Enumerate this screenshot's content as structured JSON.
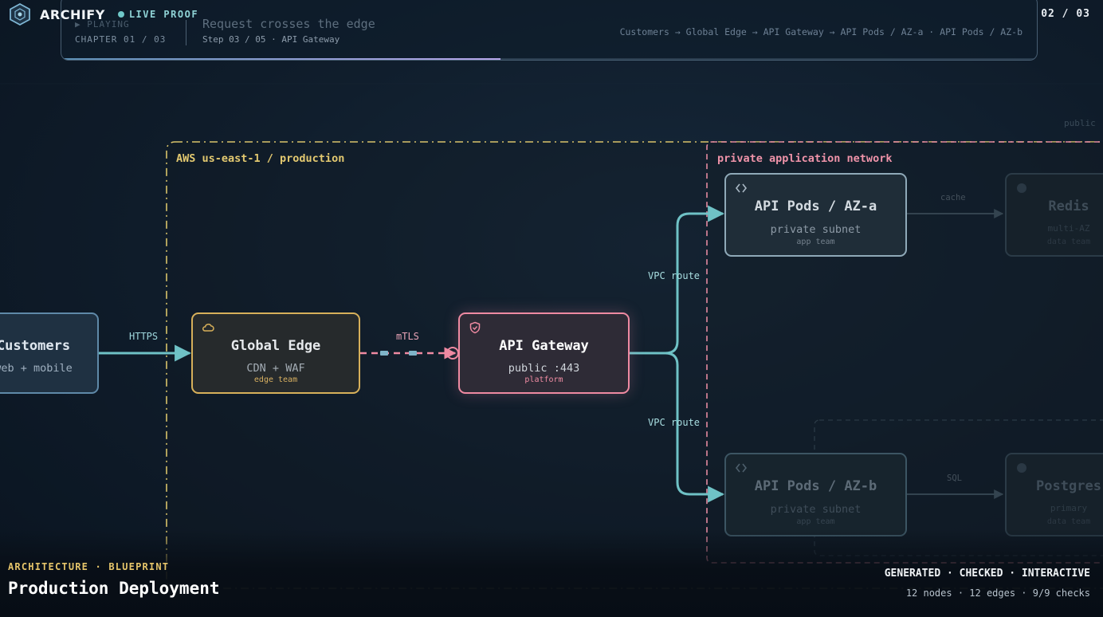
{
  "app": {
    "name": "ARCHIFY",
    "status": "LIVE PROOF",
    "page_counter": "02 / 03"
  },
  "chapter_card": {
    "now_playing": "▶ PLAYING",
    "chapter": "CHAPTER 01 / 03",
    "title": "Request crosses the edge",
    "step": "Step 03 / 05 · API Gateway",
    "path": "Customers → Global Edge → API Gateway → API Pods / AZ-a · API Pods / AZ-b",
    "progress": 0.45
  },
  "diagram": {
    "regions": {
      "aws": "AWS us-east-1 / production",
      "private": "private application network",
      "public_hint": "public"
    },
    "nodes": {
      "customers": {
        "title": "Customers",
        "sub": "web + mobile"
      },
      "edge": {
        "title": "Global Edge",
        "sub": "CDN + WAF",
        "owner": "edge team"
      },
      "gateway": {
        "title": "API Gateway",
        "sub": "public :443",
        "owner": "platform"
      },
      "pods_a": {
        "title": "API Pods / AZ-a",
        "sub": "private subnet",
        "owner": "app team"
      },
      "pods_b": {
        "title": "API Pods / AZ-b",
        "sub": "private subnet",
        "owner": "app team"
      },
      "redis": {
        "title": "Redis",
        "sub": "multi-AZ",
        "owner": "data team"
      },
      "postgres": {
        "title": "Postgres",
        "sub": "primary",
        "owner": "data team"
      }
    },
    "edges": {
      "https": "HTTPS",
      "mtls": "mTLS",
      "vpc_a": "VPC route",
      "vpc_b": "VPC route",
      "cache": "cache",
      "sql": "SQL"
    },
    "colors": {
      "active_edge": "#6fc2c6",
      "edge_node": "#d7b05a",
      "gateway_node": "#ef8aa2",
      "region_aws": "#d9c36a",
      "region_private": "#e58aa0"
    }
  },
  "footer": {
    "eyebrow": "ARCHITECTURE · BLUEPRINT",
    "title": "Production Deployment",
    "flags": "GENERATED · CHECKED · INTERACTIVE",
    "stats": "12 nodes · 12 edges · 9/9 checks"
  }
}
